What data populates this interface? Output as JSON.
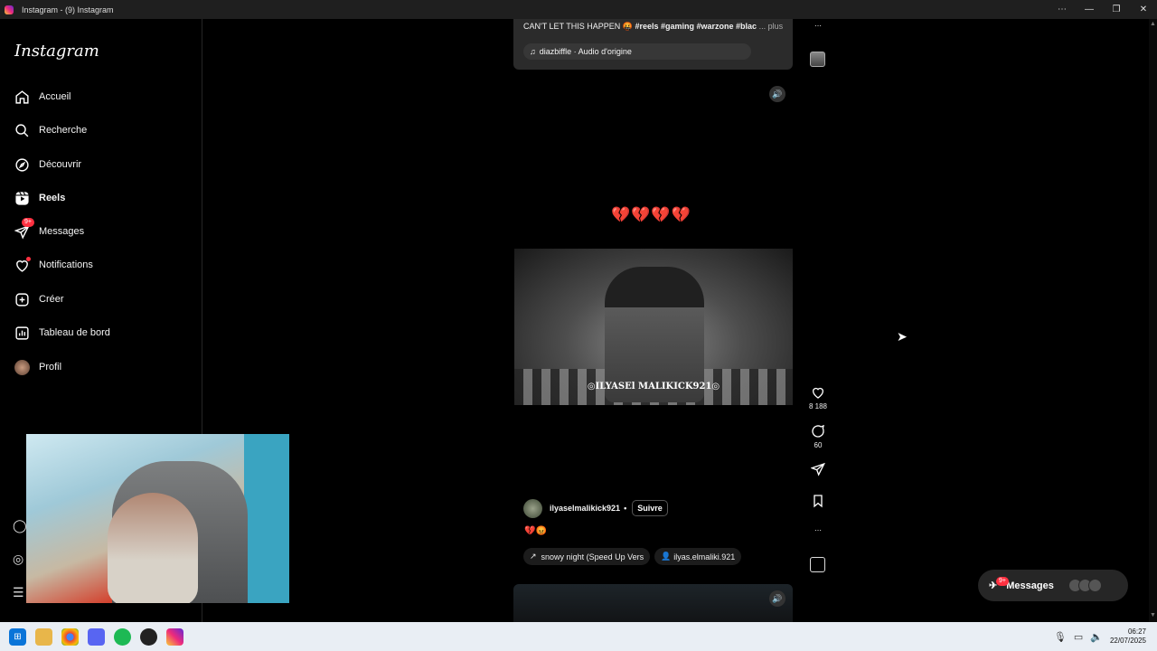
{
  "window": {
    "title": "Instagram - (9) Instagram",
    "controls": [
      "⋯",
      "—",
      "❐",
      "✕"
    ]
  },
  "sidebar": {
    "logo": "Instagram",
    "items": [
      {
        "label": "Accueil",
        "icon": "home-icon"
      },
      {
        "label": "Recherche",
        "icon": "search-icon"
      },
      {
        "label": "Découvrir",
        "icon": "compass-icon"
      },
      {
        "label": "Reels",
        "icon": "reels-icon",
        "active": true
      },
      {
        "label": "Messages",
        "icon": "messenger-icon",
        "badge": "9+"
      },
      {
        "label": "Notifications",
        "icon": "heart-icon"
      },
      {
        "label": "Créer",
        "icon": "plus-square-icon"
      },
      {
        "label": "Tableau de bord",
        "icon": "chart-icon"
      },
      {
        "label": "Profil",
        "icon": "avatar-icon"
      }
    ]
  },
  "reel_prev": {
    "caption_start": "CAN'T LET THIS HAPPEN 🤬",
    "caption_tags": "#reels #gaming #warzone #blac",
    "caption_more": "... plus",
    "audio": "diazbiffle · Audio d'origine"
  },
  "reel": {
    "overlay_text": "💔💔💔💔",
    "watermark": "◎ILYASEl MALIKICK921◎",
    "author": "ilyaselmalikick921",
    "separator": "•",
    "follow_label": "Suivre",
    "caption_emojis": "💔😡",
    "audio_chip": "snowy night (Speed Up Vers",
    "tag_chip": "ilyas.elmaliki.921",
    "likes": "8 188",
    "comments": "60"
  },
  "messages_pill": {
    "label": "Messages",
    "badge": "9+"
  },
  "taskbar": {
    "time": "06:27",
    "date": "22/07/2025"
  },
  "colors": {
    "background": "#000000",
    "badge": "#ff3040",
    "taskbar": "#e9eef4"
  }
}
